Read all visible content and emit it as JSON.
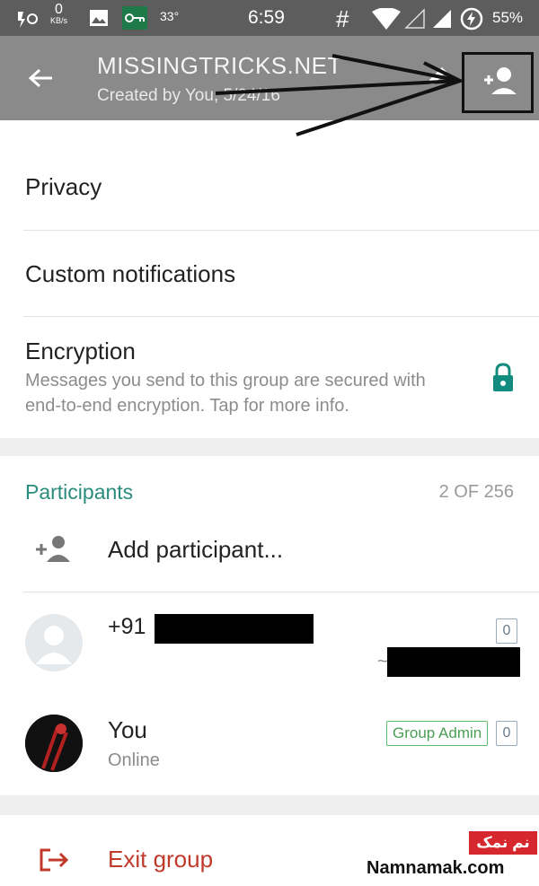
{
  "status_bar": {
    "speed": "0",
    "speed_unit": "KB/s",
    "temperature": "33°",
    "time": "6:59",
    "network_symbol": "#",
    "battery": "55%",
    "icons": [
      "usb-debug-icon",
      "image-icon",
      "key-icon",
      "wifi-icon",
      "no-signal-icon",
      "signal-icon",
      "battery-charging-icon"
    ]
  },
  "toolbar": {
    "title": "MISSINGTRICKS.NET",
    "subtitle": "Created by You, 5/24/16",
    "icons": [
      "back-arrow-icon",
      "edit-pencil-icon",
      "add-person-icon"
    ]
  },
  "settings": {
    "privacy": "Privacy",
    "custom_notifications": "Custom notifications",
    "encryption": "Encryption",
    "encryption_desc": "Messages you send to this group are secured with end-to-end encryption. Tap for more info.",
    "encryption_icon": "lock-icon"
  },
  "participants": {
    "title": "Participants",
    "count": "2 OF 256",
    "add_label": "Add participant...",
    "members": [
      {
        "name": "+91",
        "badge": "0",
        "status": "~"
      },
      {
        "name": "You",
        "status": "Online",
        "role": "Group Admin",
        "badge": "0"
      }
    ]
  },
  "exit": {
    "label": "Exit group"
  },
  "watermark": {
    "fa": "نم نمک",
    "en": "Namnamak.com"
  },
  "colors": {
    "status_bar": "#5d5d5d",
    "toolbar": "#8a8a8a",
    "accent": "#2a8c7c",
    "danger": "#c0392b",
    "admin_green": "#4a9f55",
    "watermark_red": "#d6262e"
  }
}
